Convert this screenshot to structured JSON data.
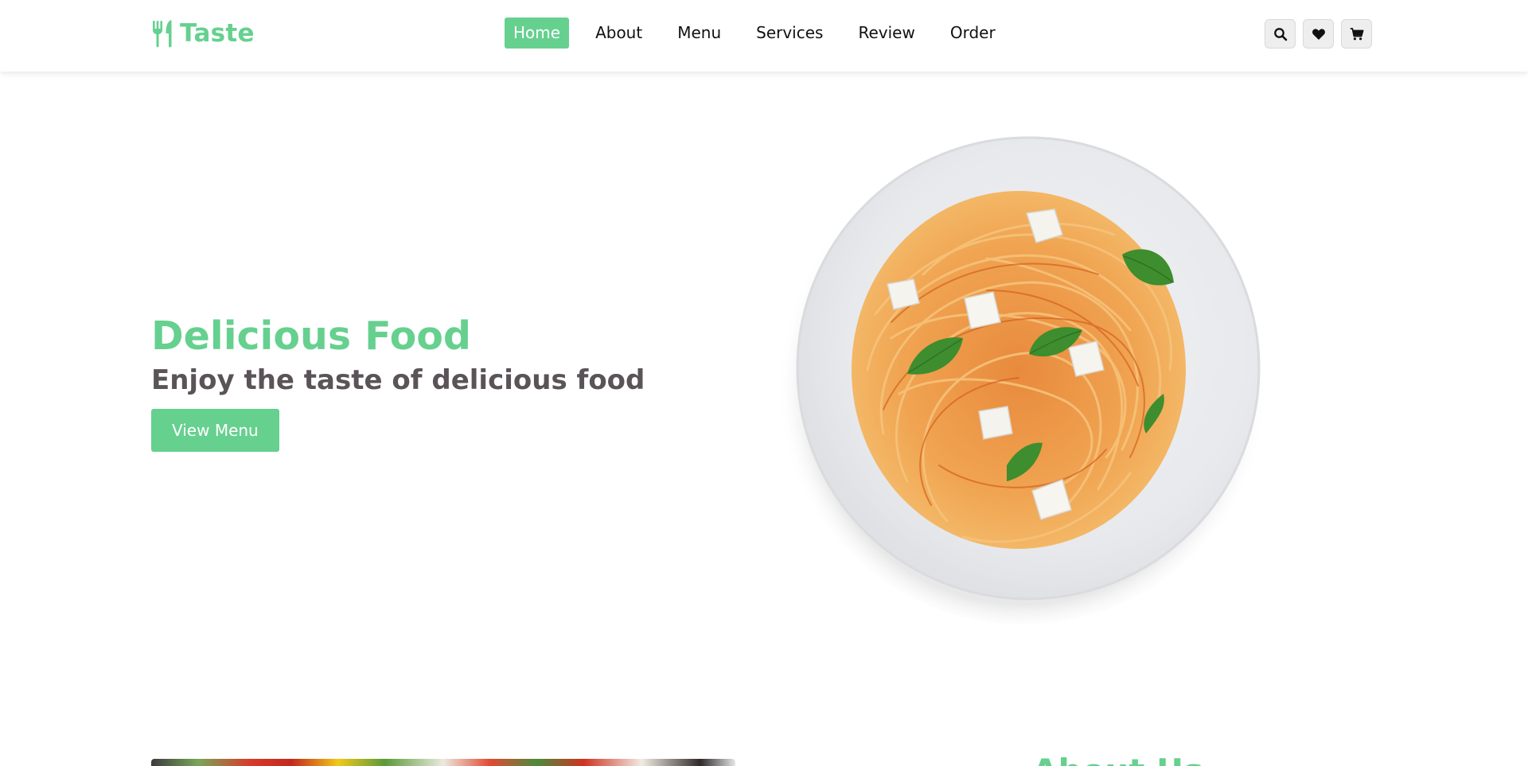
{
  "brand": {
    "name": "Taste",
    "accent_color": "#66d08f",
    "icon": "fork-knife-icon"
  },
  "nav": {
    "items": [
      {
        "label": "Home",
        "active": true
      },
      {
        "label": "About",
        "active": false
      },
      {
        "label": "Menu",
        "active": false
      },
      {
        "label": "Services",
        "active": false
      },
      {
        "label": "Review",
        "active": false
      },
      {
        "label": "Order",
        "active": false
      }
    ]
  },
  "header_icons": [
    "search-icon",
    "heart-icon",
    "cart-icon"
  ],
  "hero": {
    "title": "Delicious Food",
    "subtitle": "Enjoy the taste of delicious food",
    "button_label": "View Menu",
    "image": "spaghetti-plate-image"
  },
  "next_section": {
    "heading_partial": "About Us",
    "image": "vegetables-banner-image"
  }
}
